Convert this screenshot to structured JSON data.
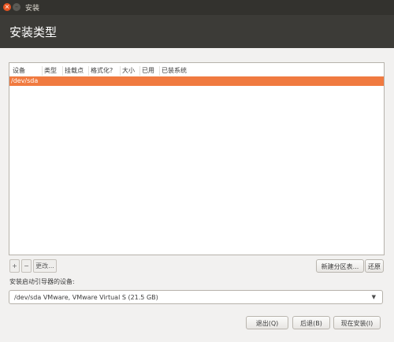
{
  "window": {
    "title": "安装",
    "close_icon": "×",
    "minimize_icon": "–"
  },
  "header": {
    "title": "安装类型"
  },
  "table": {
    "columns": [
      "设备",
      "类型",
      "挂载点",
      "格式化?",
      "大小",
      "已用",
      "已装系统"
    ],
    "rows": [
      {
        "device": "/dev/sda",
        "selected": true
      }
    ]
  },
  "partition_toolbar": {
    "add_label": "+",
    "remove_label": "−",
    "change_label": "更改...",
    "new_table_label": "新建分区表...",
    "revert_label": "还原"
  },
  "bootloader": {
    "label": "安装启动引导器的设备:",
    "selected": "/dev/sda VMware, VMware Virtual S (21.5 GB)",
    "caret": "▼"
  },
  "actions": {
    "quit_label": "退出(Q)",
    "back_label": "后退(B)",
    "install_label": "现在安装(I)"
  },
  "colors": {
    "accent": "#f07a40",
    "header_bg": "#3c3b37",
    "close": "#e95420"
  }
}
